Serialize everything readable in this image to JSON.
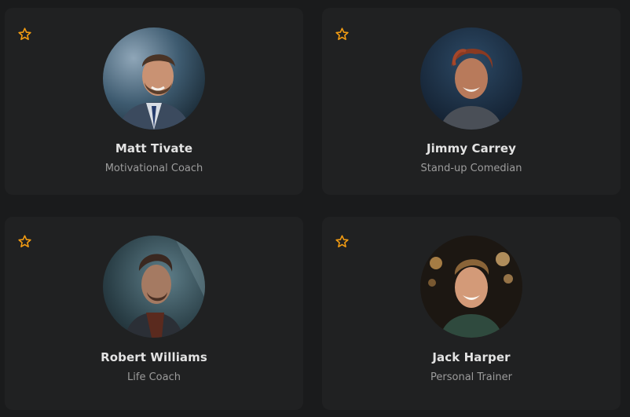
{
  "colors": {
    "background": "#1a1b1c",
    "card": "#202122",
    "star_accent": "#f39c12",
    "name_text": "#e3e3e3",
    "role_text": "#9c9c9c"
  },
  "profiles": [
    {
      "name": "Matt Tivate",
      "role": "Motivational Coach",
      "favorited": false,
      "icon": "star-outline-icon"
    },
    {
      "name": "Jimmy Carrey",
      "role": "Stand-up Comedian",
      "favorited": false,
      "icon": "star-outline-icon"
    },
    {
      "name": "Robert Williams",
      "role": "Life Coach",
      "favorited": false,
      "icon": "star-outline-icon"
    },
    {
      "name": "Jack Harper",
      "role": "Personal Trainer",
      "favorited": false,
      "icon": "star-outline-icon"
    }
  ]
}
